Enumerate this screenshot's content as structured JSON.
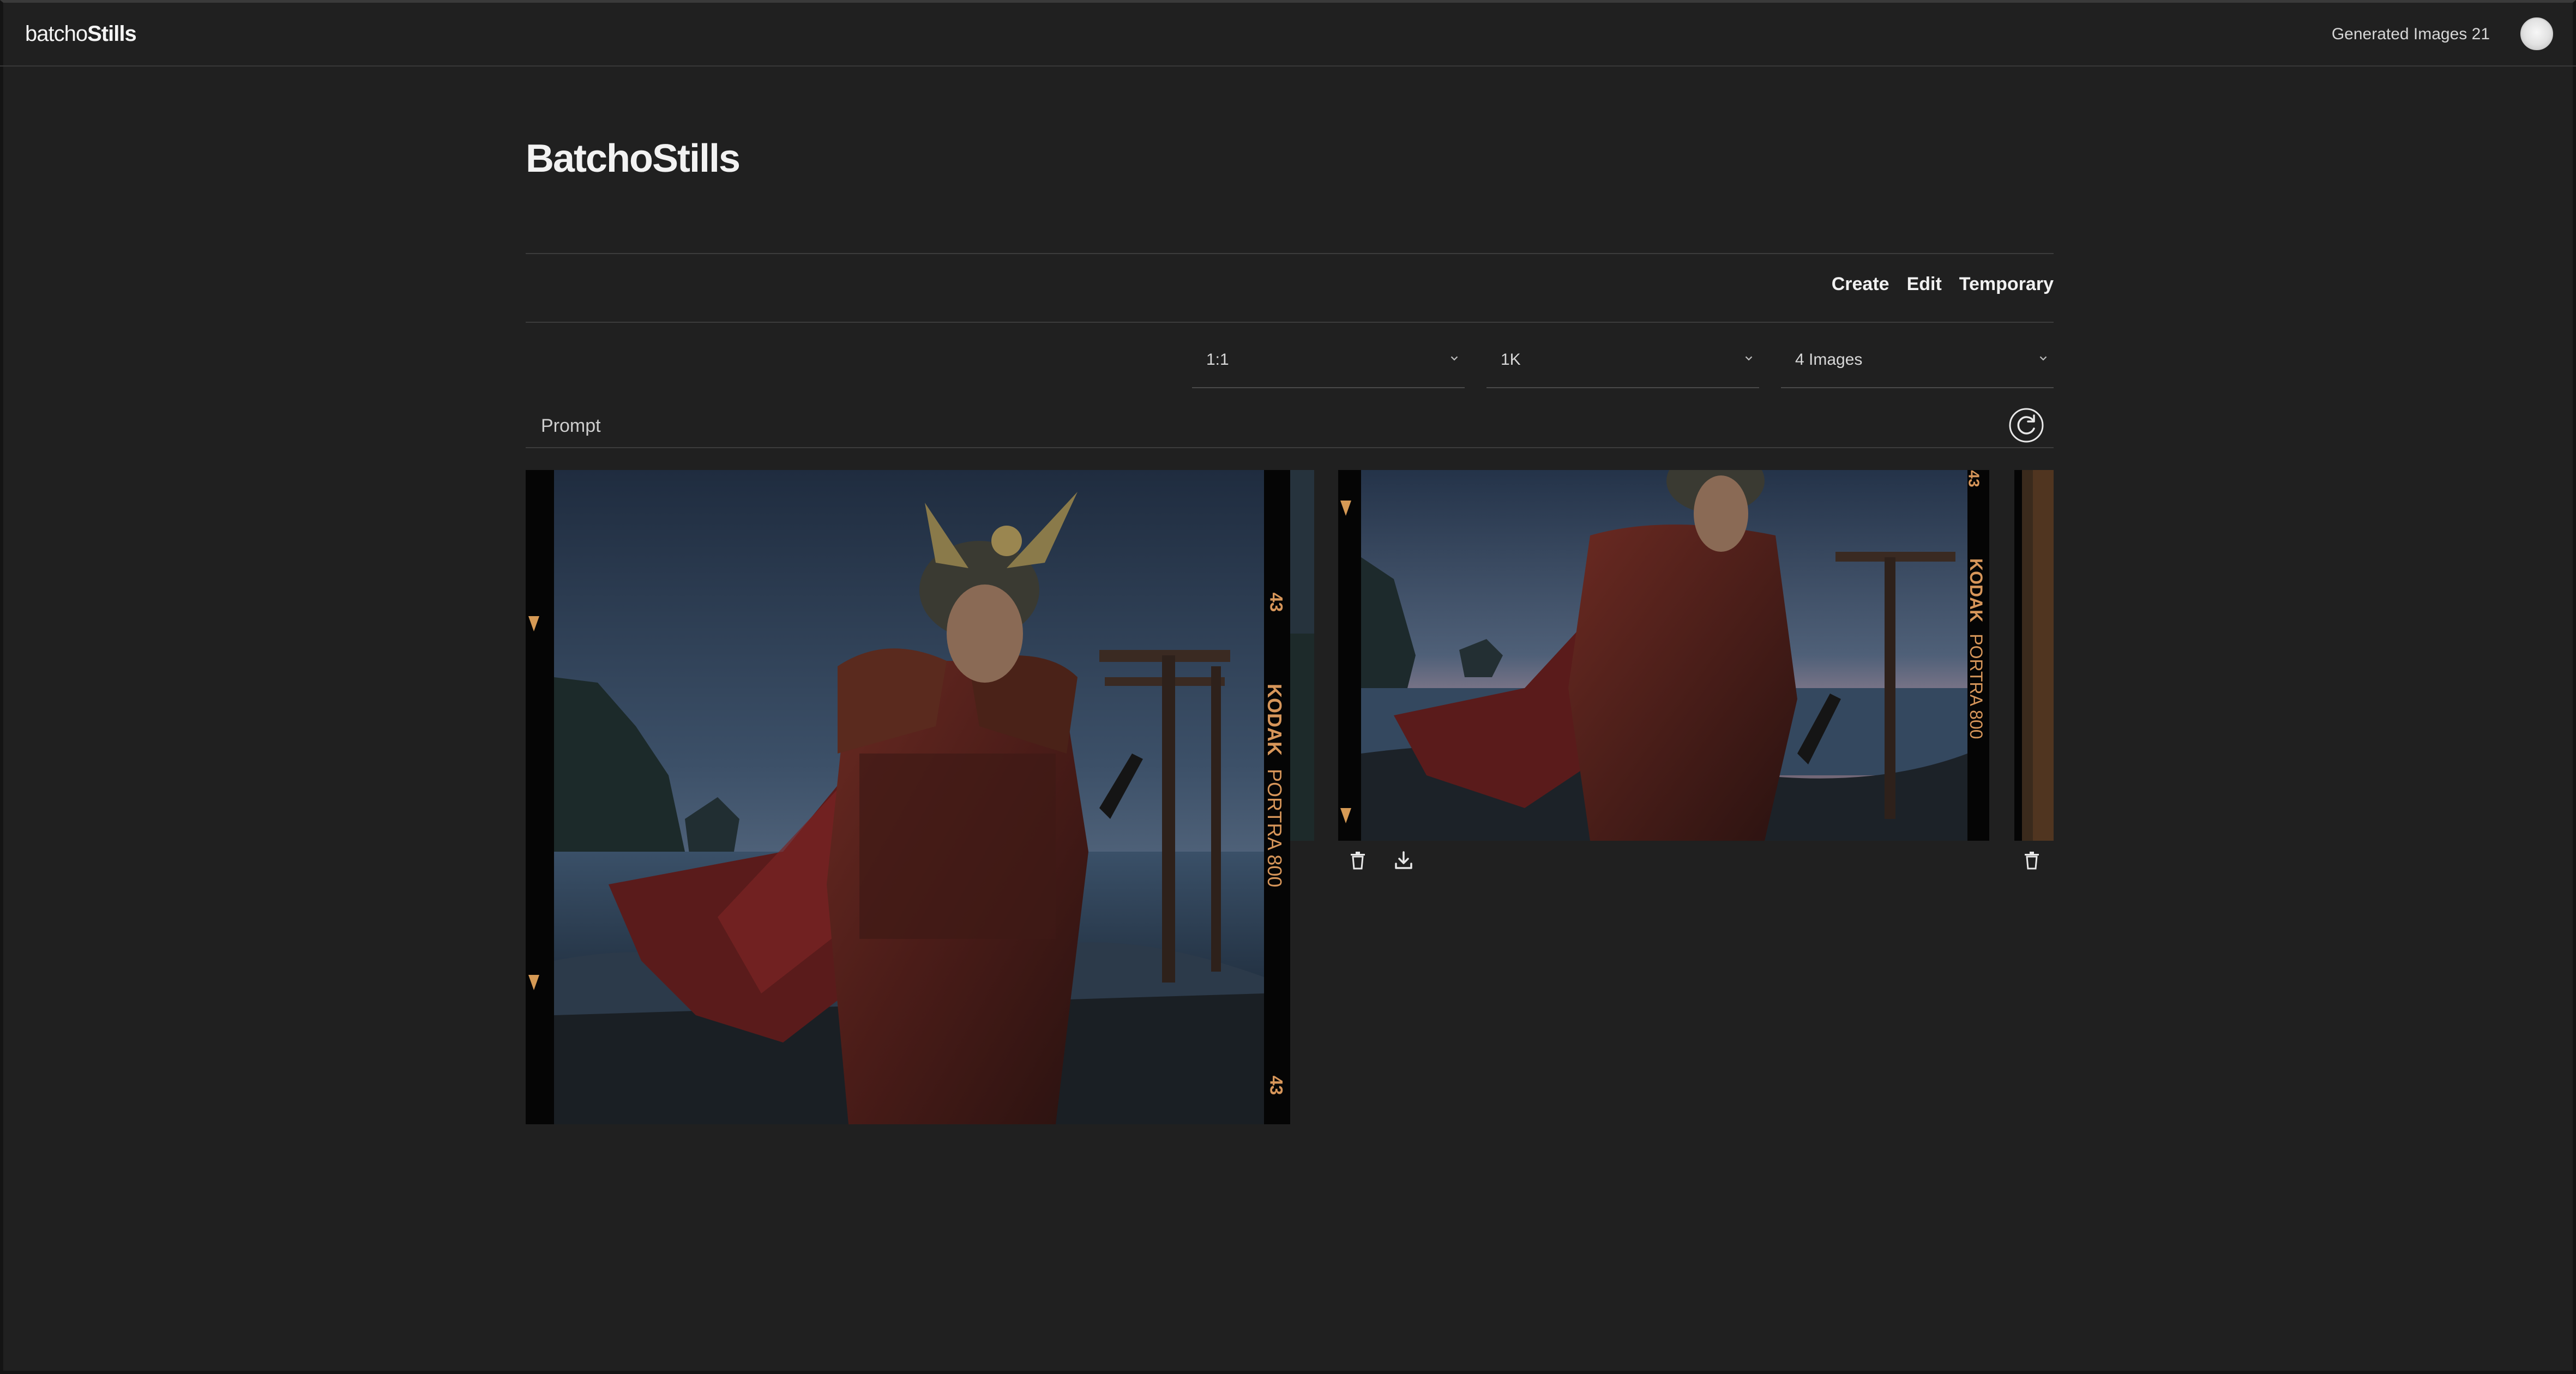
{
  "brand": {
    "logo_thin": "batcho",
    "logo_bold": "Stills"
  },
  "header": {
    "generated_label": "Generated Images 21"
  },
  "page": {
    "title": "BatchoStills"
  },
  "modes": [
    "Create",
    "Edit",
    "Temporary"
  ],
  "settings": {
    "aspect_ratio": "1:1",
    "resolution": "1K",
    "count": "4 Images"
  },
  "prompt": {
    "placeholder": "Prompt",
    "value": ""
  },
  "film": {
    "brand": "KODAK",
    "stock": "PORTRA 800",
    "frame_number": "43"
  },
  "icons": {
    "refresh": "refresh-icon",
    "delete": "trash-icon",
    "download": "download-icon",
    "chevron": "chevron-down-icon"
  },
  "colors": {
    "background": "#202020",
    "film_orange": "#d7965a"
  }
}
